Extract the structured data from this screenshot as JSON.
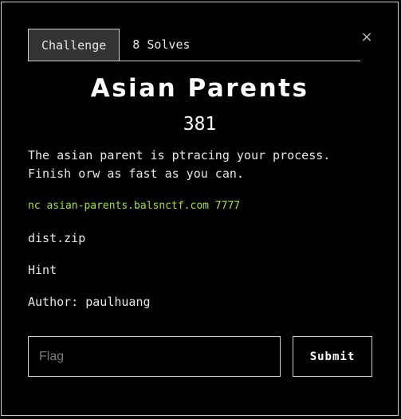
{
  "tabs": {
    "challenge": "Challenge",
    "solves": "8 Solves"
  },
  "close_icon": "×",
  "challenge": {
    "title": "Asian Parents",
    "points": "381",
    "description_line1": "The asian parent is ptracing your process.",
    "description_line2": "Finish orw as fast as you can.",
    "connection": "nc asian-parents.balsnctf.com 7777",
    "file_link": "dist.zip",
    "hint_link": "Hint",
    "author": "Author: paulhuang"
  },
  "flag": {
    "placeholder": "Flag",
    "value": ""
  },
  "submit_label": "Submit",
  "colors": {
    "background": "#000000",
    "border": "#cfcfcf",
    "active_tab": "#333333",
    "connection_text": "#a6e22e"
  }
}
